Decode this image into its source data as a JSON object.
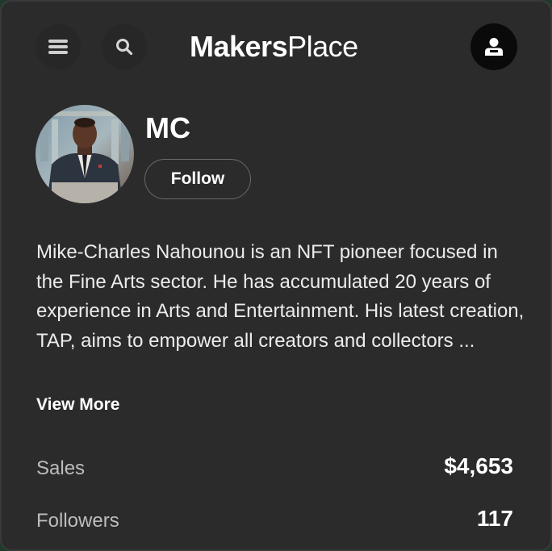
{
  "header": {
    "logo_bold": "Makers",
    "logo_light": "Place",
    "menu_icon": "hamburger-menu-icon",
    "search_icon": "search-icon",
    "account_icon": "user-account-icon"
  },
  "profile": {
    "name": "MC",
    "follow_label": "Follow",
    "bio": "Mike-Charles Nahounou is an NFT pioneer focused in the Fine Arts sector. He has accumulated 20 years of experience in Arts and Entertainment. His latest creation, TAP, aims to empower all creators and collectors ...",
    "view_more_label": "View More"
  },
  "stats": {
    "sales_label": "Sales",
    "sales_value": "$4,653",
    "followers_label": "Followers",
    "followers_value": "117"
  },
  "colors": {
    "card_background": "#2b2b2b",
    "outer_background": "#1f3a2c",
    "text_primary": "#ffffff",
    "text_secondary": "#bdbdbd"
  }
}
